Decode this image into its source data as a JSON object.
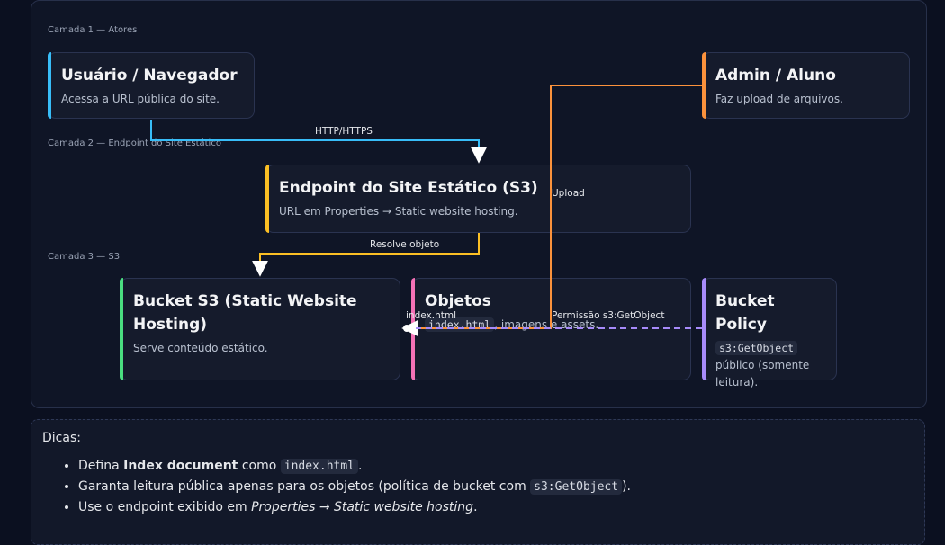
{
  "layers": {
    "layer1": "Camada 1 — Atores",
    "layer2": "Camada 2 — Endpoint do Site Estático",
    "layer3": "Camada 3 — S3"
  },
  "nodes": {
    "user": {
      "title": "Usuário / Navegador",
      "desc": "Acessa a URL pública do site.",
      "color": "#38bdf8"
    },
    "admin": {
      "title": "Admin / Aluno",
      "desc": "Faz upload de arquivos.",
      "color": "#fb923c"
    },
    "endpoint": {
      "title": "Endpoint do Site Estático (S3)",
      "desc": "URL em Properties → Static website hosting.",
      "color": "#fbbf24"
    },
    "bucket": {
      "title_line1": "Bucket S3 (Static Website",
      "title_line2": "Hosting)",
      "desc": "Serve conteúdo estático.",
      "color": "#4ade80"
    },
    "objects": {
      "title": "Objetos",
      "desc_code": "index.html",
      "desc_rest": ", imagens e assets.",
      "color": "#f472b6"
    },
    "policy": {
      "title": "Bucket Policy",
      "desc_code": "s3:GetObject",
      "desc_rest": "público (somente leitura).",
      "color": "#a78bfa"
    }
  },
  "edges": {
    "http": "HTTP/HTTPS",
    "resolve": "Resolve objeto",
    "upload": "Upload",
    "index": "index.html",
    "permission": "Permissão s3:GetObject"
  },
  "tips": {
    "title": "Dicas:",
    "item1_a": "Defina ",
    "item1_b": "Index document",
    "item1_c": " como ",
    "item1_code": "index.html",
    "item1_d": ".",
    "item2_a": "Garanta leitura pública apenas para os objetos (política de bucket com ",
    "item2_code": "s3:GetObject",
    "item2_b": ").",
    "item3_a": "Use o endpoint exibido em ",
    "item3_em": "Properties → Static website hosting",
    "item3_b": "."
  }
}
